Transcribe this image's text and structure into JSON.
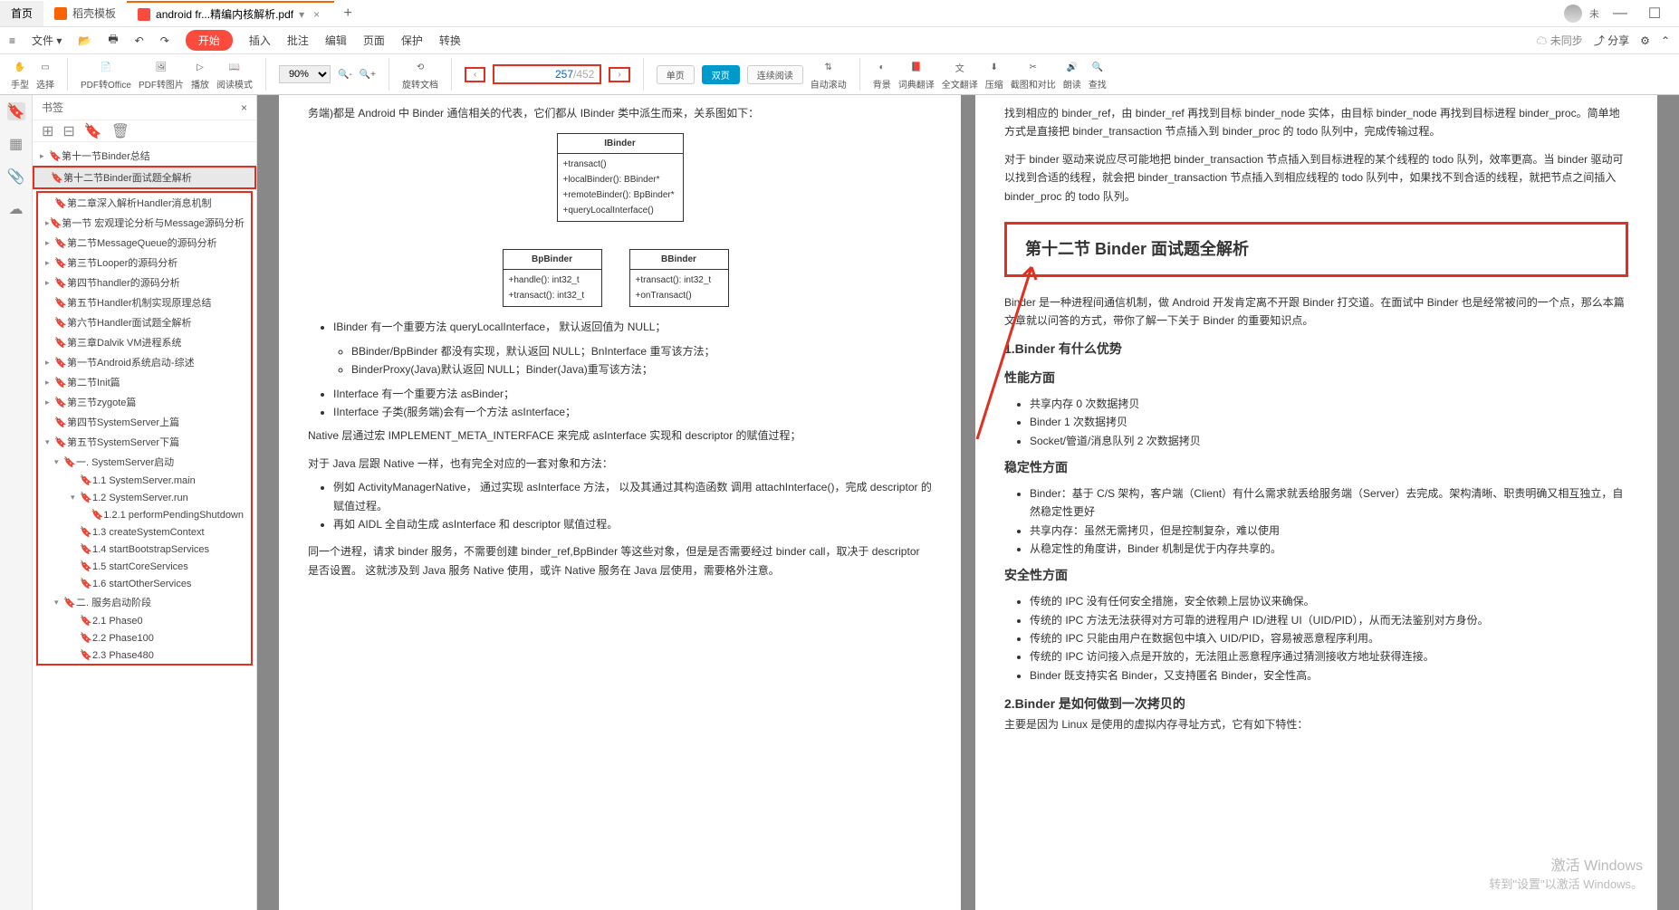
{
  "titlebar": {
    "home": "首页",
    "template": "稻壳模板",
    "active_tab": "android fr...精编内核解析.pdf",
    "user_suffix": "未"
  },
  "menubar": {
    "file_icon": "≡",
    "file": "文件",
    "start": "开始",
    "insert": "插入",
    "review": "批注",
    "edit": "编辑",
    "page": "页面",
    "protect": "保护",
    "convert": "转换",
    "unsync": "未同步",
    "share": "分享"
  },
  "toolbar": {
    "hand": "手型",
    "select": "选择",
    "pdf_office": "PDF转Office",
    "pdf_image": "PDF转图片",
    "play": "播放",
    "read_mode": "阅读模式",
    "zoom": "90%",
    "rotate": "旋转文档",
    "single": "单页",
    "double": "双页",
    "continuous": "连续阅读",
    "auto_scroll": "自动滚动",
    "background": "背景",
    "dict": "词典翻译",
    "full_trans": "全文翻译",
    "compress": "压缩",
    "crop_compare": "截图和对比",
    "read_aloud": "朗读",
    "find": "查找",
    "page_current": "257",
    "page_total": "/452"
  },
  "sidebar": {
    "title": "书签",
    "items": [
      {
        "level": 0,
        "arrow": "▸",
        "text": "第十一节Binder总结"
      },
      {
        "level": 0,
        "arrow": "",
        "text": "第十二节Binder面试题全解析",
        "selected": true
      },
      {
        "level": 0,
        "arrow": "",
        "text": "第二章深入解析Handler消息机制",
        "boxStart": true
      },
      {
        "level": 0,
        "arrow": "▸",
        "text": "第一节 宏观理论分析与Message源码分析"
      },
      {
        "level": 0,
        "arrow": "▸",
        "text": "第二节MessageQueue的源码分析"
      },
      {
        "level": 0,
        "arrow": "▸",
        "text": "第三节Looper的源码分析"
      },
      {
        "level": 0,
        "arrow": "▸",
        "text": "第四节handler的源码分析"
      },
      {
        "level": 0,
        "arrow": "",
        "text": "第五节Handler机制实现原理总结"
      },
      {
        "level": 0,
        "arrow": "",
        "text": "第六节Handler面试题全解析"
      },
      {
        "level": 0,
        "arrow": "",
        "text": "第三章Dalvik VM进程系统"
      },
      {
        "level": 0,
        "arrow": "▸",
        "text": "第一节Android系统启动-综述"
      },
      {
        "level": 0,
        "arrow": "▸",
        "text": "第二节Init篇"
      },
      {
        "level": 0,
        "arrow": "▸",
        "text": "第三节zygote篇"
      },
      {
        "level": 0,
        "arrow": "",
        "text": "第四节SystemServer上篇"
      },
      {
        "level": 0,
        "arrow": "▾",
        "text": "第五节SystemServer下篇"
      },
      {
        "level": 1,
        "arrow": "▾",
        "text": "一. SystemServer启动"
      },
      {
        "level": 2,
        "arrow": "",
        "text": "1.1 SystemServer.main"
      },
      {
        "level": 2,
        "arrow": "▾",
        "text": "1.2 SystemServer.run"
      },
      {
        "level": 3,
        "arrow": "",
        "text": "1.2.1 performPendingShutdown"
      },
      {
        "level": 2,
        "arrow": "",
        "text": "1.3 createSystemContext"
      },
      {
        "level": 2,
        "arrow": "",
        "text": "1.4 startBootstrapServices"
      },
      {
        "level": 2,
        "arrow": "",
        "text": "1.5 startCoreServices"
      },
      {
        "level": 2,
        "arrow": "",
        "text": "1.6 startOtherServices"
      },
      {
        "level": 1,
        "arrow": "▾",
        "text": "二. 服务启动阶段"
      },
      {
        "level": 2,
        "arrow": "",
        "text": "2.1 Phase0"
      },
      {
        "level": 2,
        "arrow": "",
        "text": "2.2 Phase100"
      },
      {
        "level": 2,
        "arrow": "",
        "text": "2.3 Phase480"
      }
    ]
  },
  "left_page": {
    "intro": "务端)都是 Android 中 Binder 通信相关的代表，它们都从 IBinder 类中派生而来，关系图如下：",
    "uml_ibinder": "IBinder",
    "uml_ibinder_body": "+transact()\n+localBinder(): BBinder*\n+remoteBinder(): BpBinder*\n+queryLocalInterface()",
    "uml_bp": "BpBinder",
    "uml_bp_body": "+handle(): int32_t\n+transact(): int32_t",
    "uml_bb": "BBinder",
    "uml_bb_body": "+transact(): int32_t\n+onTransact()",
    "li1": "IBinder 有一个重要方法 queryLocalInterface， 默认返回值为 NULL；",
    "li1a": "BBinder/BpBinder 都没有实现，默认返回 NULL；BnInterface 重写该方法；",
    "li1b": "BinderProxy(Java)默认返回 NULL；Binder(Java)重写该方法；",
    "li2": "IInterface 有一个重要方法 asBinder；",
    "li3": "IInterface 子类(服务端)会有一个方法 asInterface；",
    "p2": "Native 层通过宏 IMPLEMENT_META_INTERFACE 来完成 asInterface 实现和 descriptor 的赋值过程；",
    "p3": "对于 Java 层跟 Native 一样，也有完全对应的一套对象和方法：",
    "li4": "例如 ActivityManagerNative， 通过实现 asInterface 方法， 以及其通过其构造函数 调用 attachInterface()，完成 descriptor 的赋值过程。",
    "li5": "再如 AIDL 全自动生成 asInterface 和 descriptor 赋值过程。",
    "p4": "同一个进程，请求 binder 服务，不需要创建 binder_ref,BpBinder 等这些对象，但是是否需要经过 binder call，取决于 descriptor 是否设置。 这就涉及到 Java 服务 Native 使用，或许 Native 服务在 Java 层使用，需要格外注意。"
  },
  "right_page": {
    "p1": "找到相应的 binder_ref，由 binder_ref 再找到目标 binder_node 实体，由目标 binder_node 再找到目标进程 binder_proc。简单地方式是直接把 binder_transaction 节点插入到 binder_proc 的 todo 队列中，完成传输过程。",
    "p2": "对于 binder 驱动来说应尽可能地把 binder_transaction 节点插入到目标进程的某个线程的 todo 队列，效率更高。当 binder 驱动可以找到合适的线程，就会把 binder_transaction 节点插入到相应线程的 todo 队列中，如果找不到合适的线程，就把节点之间插入 binder_proc 的 todo 队列。",
    "heading": "第十二节 Binder 面试题全解析",
    "p3": "Binder 是一种进程间通信机制，做 Android 开发肯定离不开跟 Binder 打交道。在面试中 Binder 也是经常被问的一个点，那么本篇文章就以问答的方式，带你了解一下关于 Binder 的重要知识点。",
    "h1": "1.Binder 有什么优势",
    "h1a": "性能方面",
    "li1": "共享内存 0 次数据拷贝",
    "li2": "Binder 1 次数据拷贝",
    "li3": "Socket/管道/消息队列 2 次数据拷贝",
    "h1b": "稳定性方面",
    "li4": "Binder：基于 C/S 架构，客户端（Client）有什么需求就丢给服务端（Server）去完成。架构清晰、职责明确又相互独立，自然稳定性更好",
    "li5": "共享内存：虽然无需拷贝，但是控制复杂，难以使用",
    "li6": "从稳定性的角度讲，Binder 机制是优于内存共享的。",
    "h1c": "安全性方面",
    "li7": "传统的 IPC 没有任何安全措施，安全依赖上层协议来确保。",
    "li8": "传统的 IPC 方法无法获得对方可靠的进程用户 ID/进程 UI（UID/PID），从而无法鉴别对方身份。",
    "li9": "传统的 IPC 只能由用户在数据包中填入 UID/PID，容易被恶意程序利用。",
    "li10": "传统的 IPC 访问接入点是开放的，无法阻止恶意程序通过猜测接收方地址获得连接。",
    "li11": "Binder 既支持实名 Binder，又支持匿名 Binder，安全性高。",
    "h2": "2.Binder 是如何做到一次拷贝的",
    "p4": "主要是因为 Linux 是使用的虚拟内存寻址方式，它有如下特性："
  },
  "watermark": {
    "l1": "激活 Windows",
    "l2": "转到\"设置\"以激活 Windows。"
  }
}
